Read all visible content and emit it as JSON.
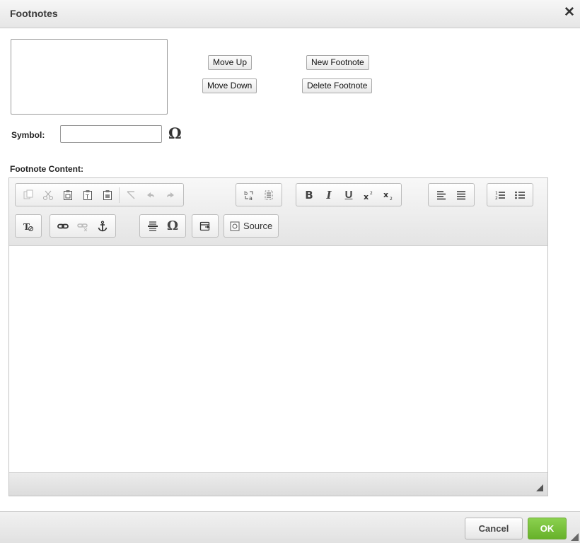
{
  "dialog": {
    "title": "Footnotes",
    "close_glyph": "✕"
  },
  "footnote_list": {
    "items": []
  },
  "buttons": {
    "move_up": "Move Up",
    "move_down": "Move Down",
    "new_footnote": "New Footnote",
    "delete_footnote": "Delete Footnote"
  },
  "symbol": {
    "label": "Symbol:",
    "value": "",
    "special_char_glyph": "Ω"
  },
  "content": {
    "label": "Footnote Content:"
  },
  "toolbar": {
    "row1": [
      [
        "copy-icon",
        "cut-icon",
        "paste-icon",
        "paste-text-icon",
        "paste-word-icon"
      ],
      [
        "remove-format-icon",
        "undo-icon",
        "redo-icon"
      ],
      [
        "find-replace-icon",
        "select-all-icon"
      ],
      [
        "bold-icon",
        "italic-icon",
        "underline-icon",
        "superscript-icon",
        "subscript-icon"
      ],
      [
        "align-left-icon",
        "justify-icon"
      ],
      [
        "numbered-list-icon",
        "bulleted-list-icon"
      ]
    ],
    "labels": {
      "bold": "B",
      "italic": "I",
      "underline": "U",
      "omega": "Ω",
      "source": "Source"
    }
  },
  "footer": {
    "cancel": "Cancel",
    "ok": "OK"
  },
  "colors": {
    "ok_green": "#67b12a",
    "title_bar": "#e6e6e6"
  }
}
